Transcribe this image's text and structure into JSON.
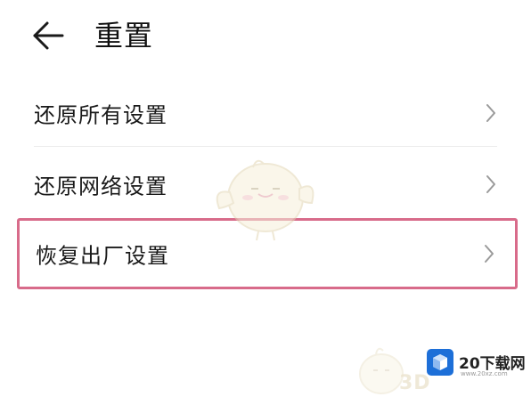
{
  "header": {
    "title": "重置",
    "back_icon": "arrow-left-icon"
  },
  "items": [
    {
      "label": "还原所有设置",
      "icon": "chevron-right-icon",
      "highlighted": false
    },
    {
      "label": "还原网络设置",
      "icon": "chevron-right-icon",
      "highlighted": false
    },
    {
      "label": "恢复出厂设置",
      "icon": "chevron-right-icon",
      "highlighted": true
    }
  ],
  "watermark": {
    "text": "3D"
  },
  "site_logo": {
    "name": "20下载网",
    "url": "www.20xz.com"
  },
  "colors": {
    "highlight_border": "#d86b8a",
    "divider": "#ececec",
    "logo_blue": "#1d6fd8"
  }
}
